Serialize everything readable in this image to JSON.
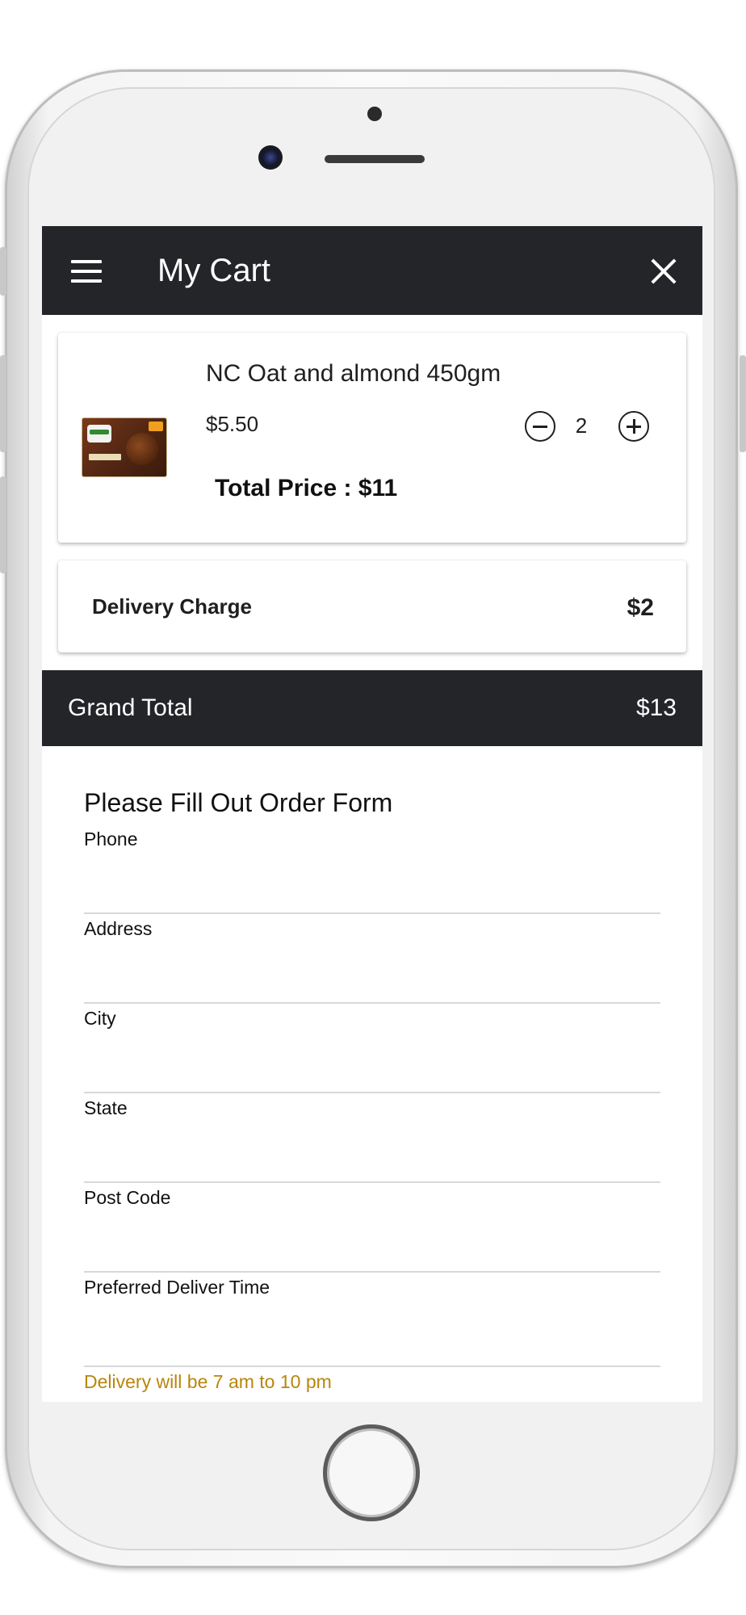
{
  "header": {
    "title": "My Cart",
    "menu_icon": "hamburger-menu-icon",
    "close_icon": "close-icon"
  },
  "cart": {
    "items": [
      {
        "name": "NC Oat and almond 450gm",
        "price": "$5.50",
        "quantity": "2",
        "total_price": "Total Price : $11"
      }
    ]
  },
  "delivery": {
    "label": "Delivery Charge",
    "value": "$2"
  },
  "grand_total": {
    "label": "Grand Total",
    "value": "$13"
  },
  "order_form": {
    "title": "Please Fill Out Order Form",
    "fields": [
      {
        "label": "Phone",
        "value": ""
      },
      {
        "label": "Address",
        "value": ""
      },
      {
        "label": "City",
        "value": ""
      },
      {
        "label": "State",
        "value": ""
      },
      {
        "label": "Post Code",
        "value": ""
      },
      {
        "label": "Preferred Deliver Time",
        "value": ""
      }
    ],
    "note": "Delivery will be 7 am to 10 pm"
  },
  "colors": {
    "appbar": "#242528",
    "note": "#b8860b"
  }
}
